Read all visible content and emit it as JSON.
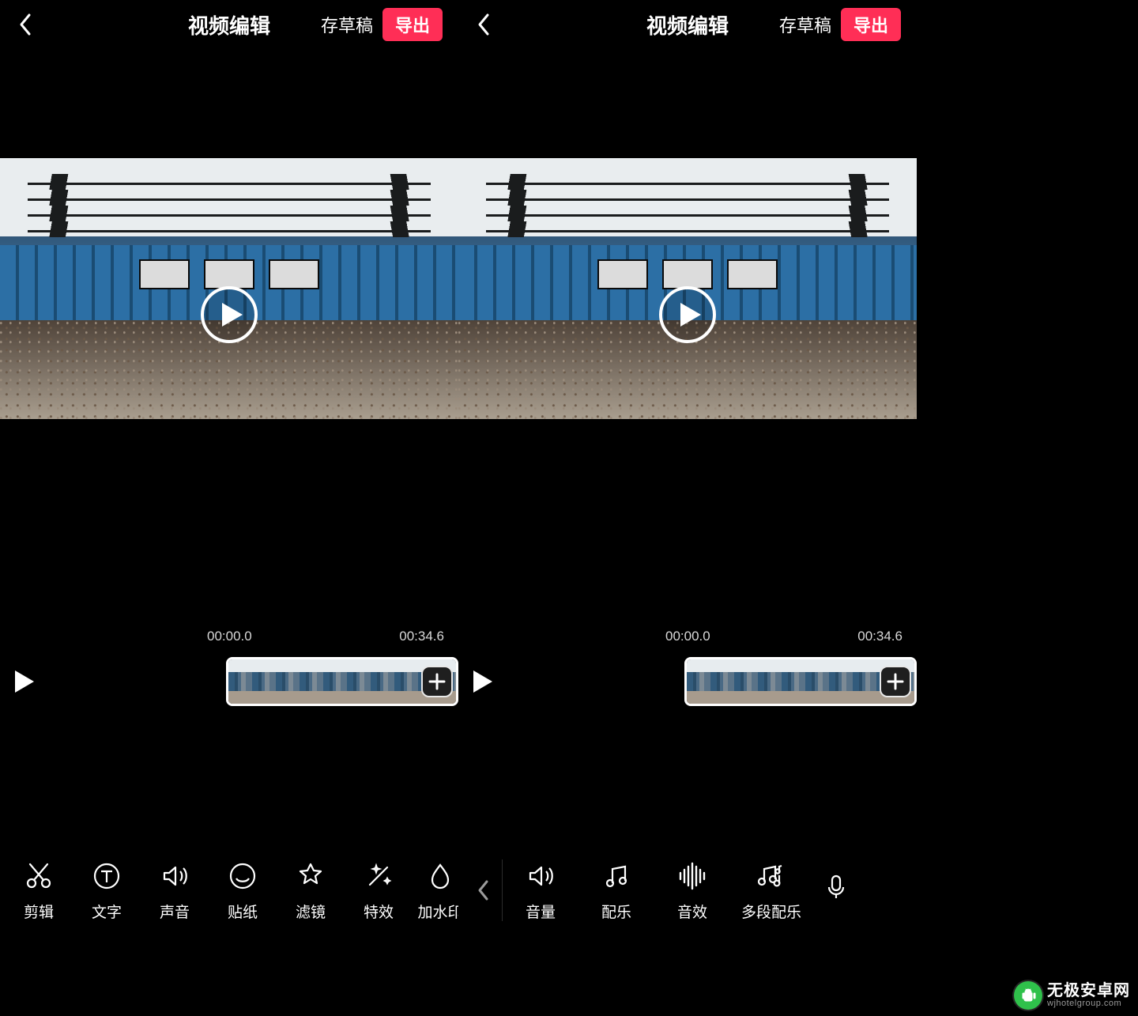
{
  "left": {
    "header": {
      "title": "视频编辑",
      "draft": "存草稿",
      "export": "导出"
    },
    "timeline": {
      "start": "00:00.0",
      "end": "00:34.6"
    },
    "tools": [
      {
        "id": "cut",
        "label": "剪辑"
      },
      {
        "id": "text",
        "label": "文字"
      },
      {
        "id": "sound",
        "label": "声音"
      },
      {
        "id": "sticker",
        "label": "贴纸"
      },
      {
        "id": "filter",
        "label": "滤镜"
      },
      {
        "id": "effect",
        "label": "特效"
      },
      {
        "id": "watermark",
        "label": "加水印"
      }
    ]
  },
  "right": {
    "header": {
      "title": "视频编辑",
      "draft": "存草稿",
      "export": "导出"
    },
    "timeline": {
      "start": "00:00.0",
      "end": "00:34.6"
    },
    "tools": [
      {
        "id": "volume",
        "label": "音量"
      },
      {
        "id": "music",
        "label": "配乐"
      },
      {
        "id": "soundfx",
        "label": "音效"
      },
      {
        "id": "multi-music",
        "label": "多段配乐"
      },
      {
        "id": "voiceover",
        "label": ""
      }
    ]
  },
  "logo": {
    "main": "无极安卓网",
    "sub": "wjhotelgroup.com"
  },
  "colors": {
    "accent": "#ff2e56"
  }
}
